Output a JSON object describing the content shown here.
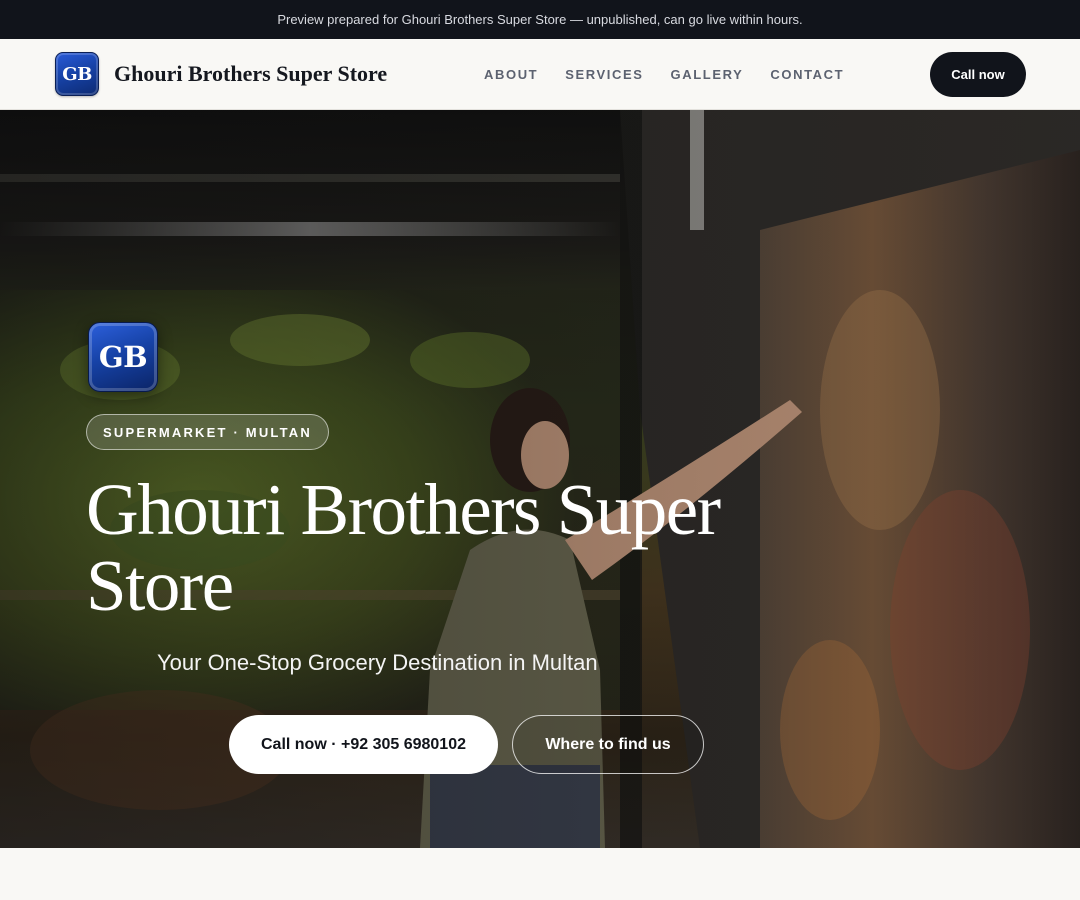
{
  "preview_banner": {
    "text": "Preview prepared for Ghouri Brothers Super Store — unpublished, can go live within hours."
  },
  "header": {
    "logo_text": "GB",
    "brand_name": "Ghouri Brothers Super Store",
    "nav": [
      {
        "label": "ABOUT"
      },
      {
        "label": "SERVICES"
      },
      {
        "label": "GALLERY"
      },
      {
        "label": "CONTACT"
      }
    ],
    "cta_label": "Call now"
  },
  "hero": {
    "logo_text": "GB",
    "tag": "SUPERMARKET · MULTAN",
    "title": "Ghouri Brothers Super Store",
    "subtitle": "Your One-Stop Grocery Destination in Multan",
    "primary_button": "Call now · +92 305 6980102",
    "secondary_button": "Where to find us"
  },
  "colors": {
    "banner_bg": "#11141b",
    "page_bg": "#f9f8f5",
    "logo_blue": "#1743a8",
    "cta_dark": "#11141b"
  }
}
